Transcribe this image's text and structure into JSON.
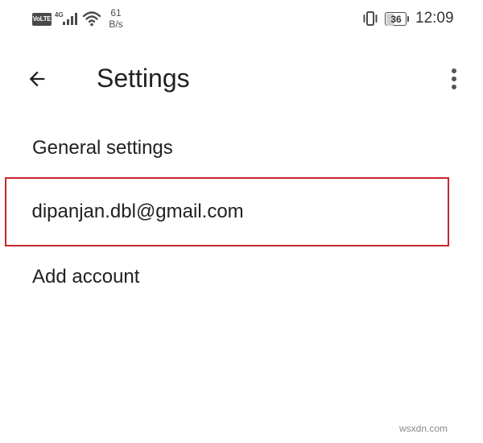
{
  "status_bar": {
    "volte_label": "VoLTE",
    "network_type": "4G",
    "net_speed_value": "61",
    "net_speed_unit": "B/s",
    "battery_percent": "36",
    "battery_level": 0.36,
    "time": "12:09",
    "icons": [
      "signal-icon",
      "wifi-icon",
      "vibrate-icon",
      "battery-icon"
    ]
  },
  "app_bar": {
    "title": "Settings",
    "back_icon": "arrow-back-icon",
    "menu_icon": "more-vert-icon"
  },
  "settings": {
    "items": [
      {
        "label": "General settings",
        "highlighted": false
      },
      {
        "label": "dipanjan.dbl@gmail.com",
        "highlighted": true
      },
      {
        "label": "Add account",
        "highlighted": false
      }
    ]
  },
  "highlight_color": "#c8252d",
  "watermark": "wsxdn.com"
}
